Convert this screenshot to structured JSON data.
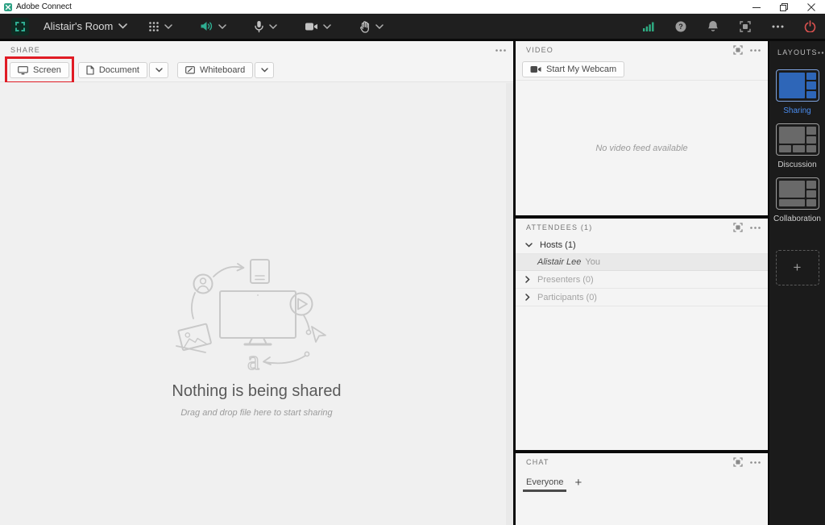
{
  "window": {
    "title": "Adobe Connect"
  },
  "toolbar": {
    "room_name": "Alistair's Room"
  },
  "share": {
    "title": "SHARE",
    "screen_label": "Screen",
    "document_label": "Document",
    "whiteboard_label": "Whiteboard",
    "empty_title": "Nothing is being shared",
    "empty_hint": "Drag and drop file here to start sharing"
  },
  "video": {
    "title": "VIDEO",
    "start_webcam_label": "Start My Webcam",
    "empty_text": "No video feed available"
  },
  "attendees": {
    "title": "ATTENDEES (1)",
    "hosts_label": "Hosts (1)",
    "host_name": "Alistair Lee",
    "host_suffix": "You",
    "presenters_label": "Presenters (0)",
    "participants_label": "Participants (0)"
  },
  "chat": {
    "title": "CHAT",
    "tab_label": "Everyone",
    "add_tab_label": "+"
  },
  "layouts": {
    "title": "LAYOUTS",
    "items": [
      {
        "label": "Sharing"
      },
      {
        "label": "Discussion"
      },
      {
        "label": "Collaboration"
      }
    ],
    "add_label": "+",
    "active": "Sharing"
  },
  "icons": {
    "help_glyph": "?"
  },
  "colors": {
    "accent_teal": "#2fae92",
    "signal_green": "#2fae84",
    "power_red": "#dd5250",
    "layout_blue": "#2e66b8",
    "annotation_red": "#e01b24",
    "toolbar_bg": "#1f1f1f"
  }
}
